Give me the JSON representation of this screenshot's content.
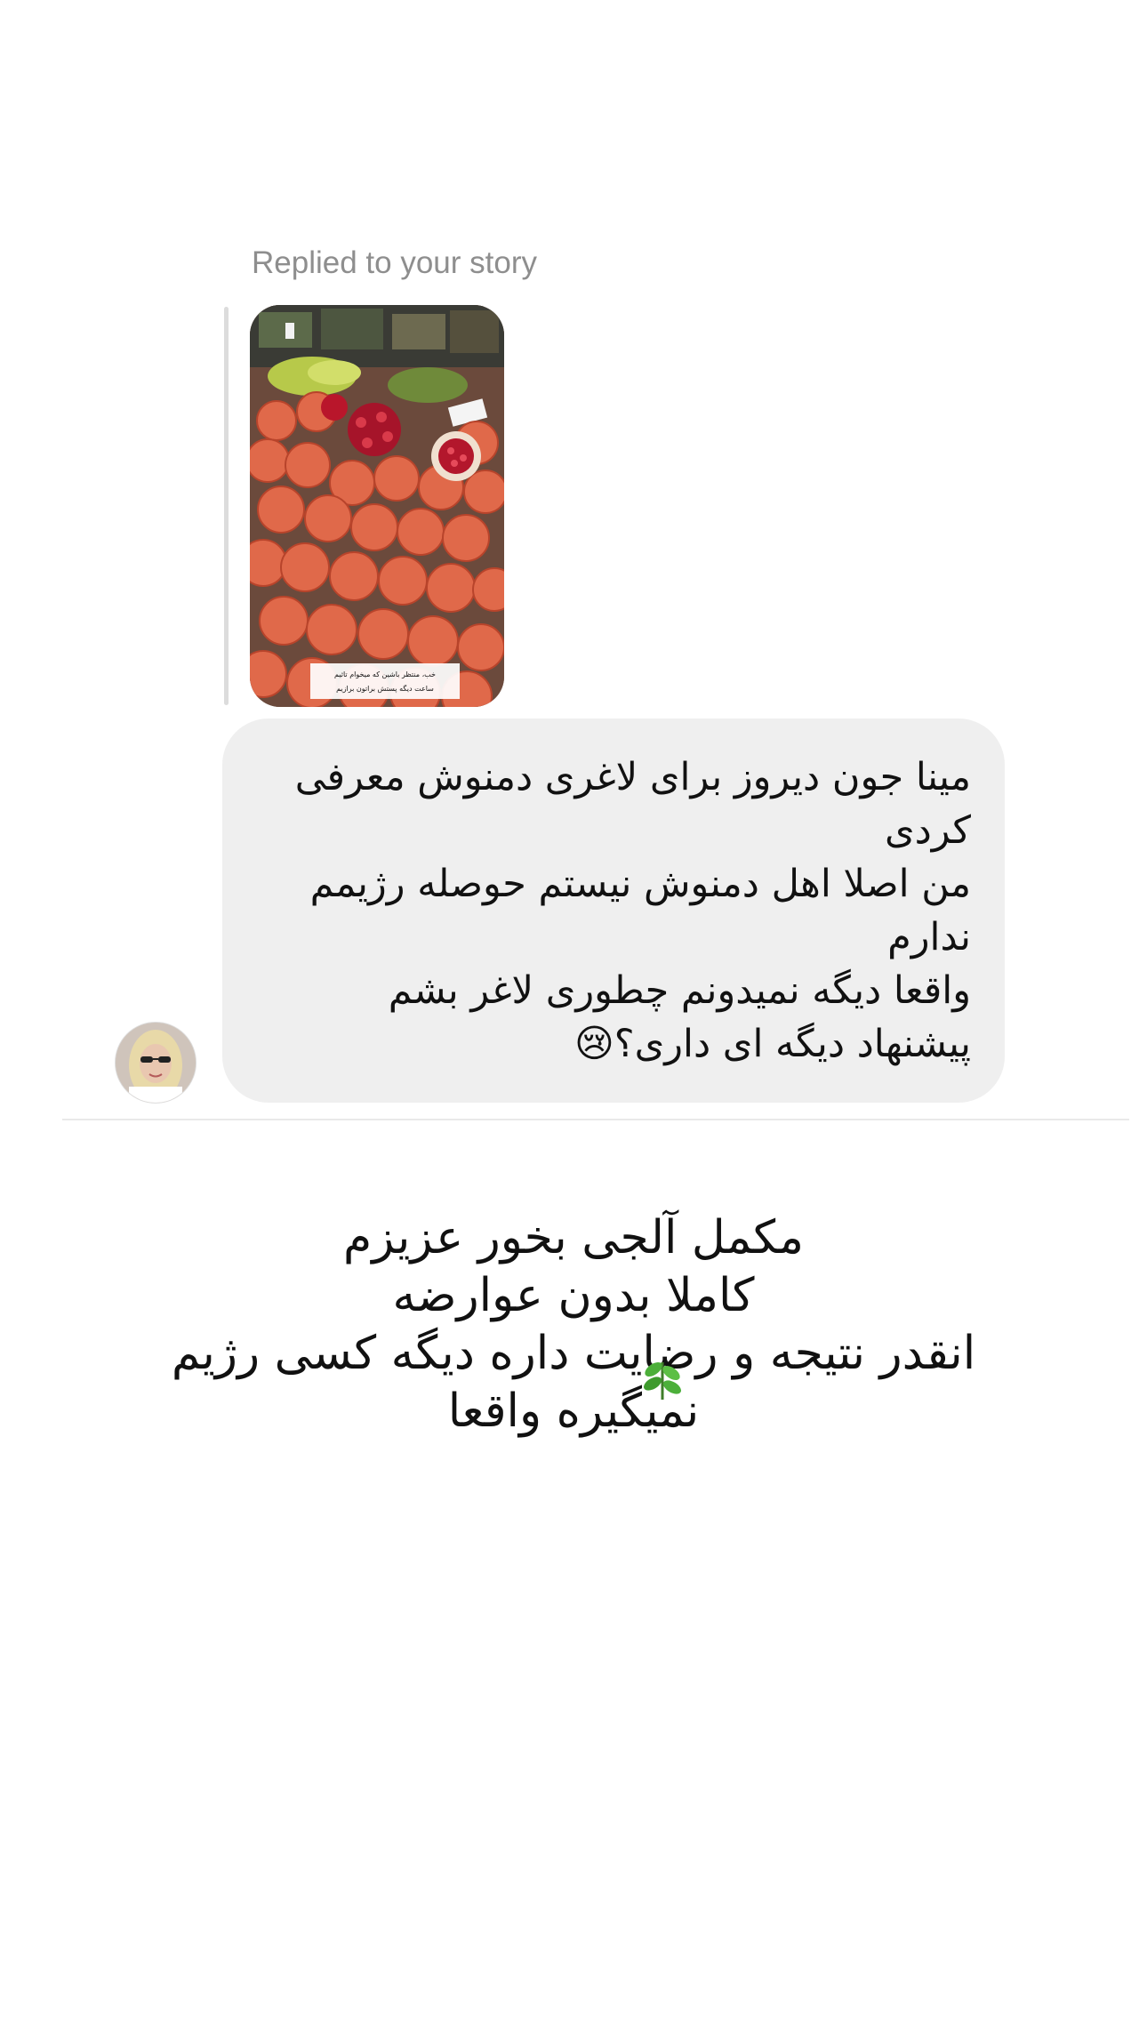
{
  "story_reply": {
    "label": "Replied to your story",
    "story_caption": [
      "خب، منتظر باشین که میخوام تاثیم",
      "ساعت دیگه پستش براتون برازیم"
    ]
  },
  "message": {
    "lines": [
      "مینا جون دیروز برای لاغری دمنوش معرفی",
      "کردی",
      "من اصلا اهل دمنوش نیستم حوصله رژیمم",
      "ندارم",
      "واقعا دیگه نمیدونم چطوری لاغر بشم",
      "پیشنهاد دیگه ای داری؟😢"
    ]
  },
  "reply": {
    "lines": [
      "مکمل آلجی بخور عزیزم",
      "کاملا بدون عوارضه",
      "انقدر نتیجه و رضایت داره دیگه کسی رژیم",
      "نمیگیره واقعا"
    ],
    "icon": "leaf-icon"
  },
  "colors": {
    "bubble": "#efefef",
    "label": "#8e8e8e",
    "text": "#111111"
  }
}
